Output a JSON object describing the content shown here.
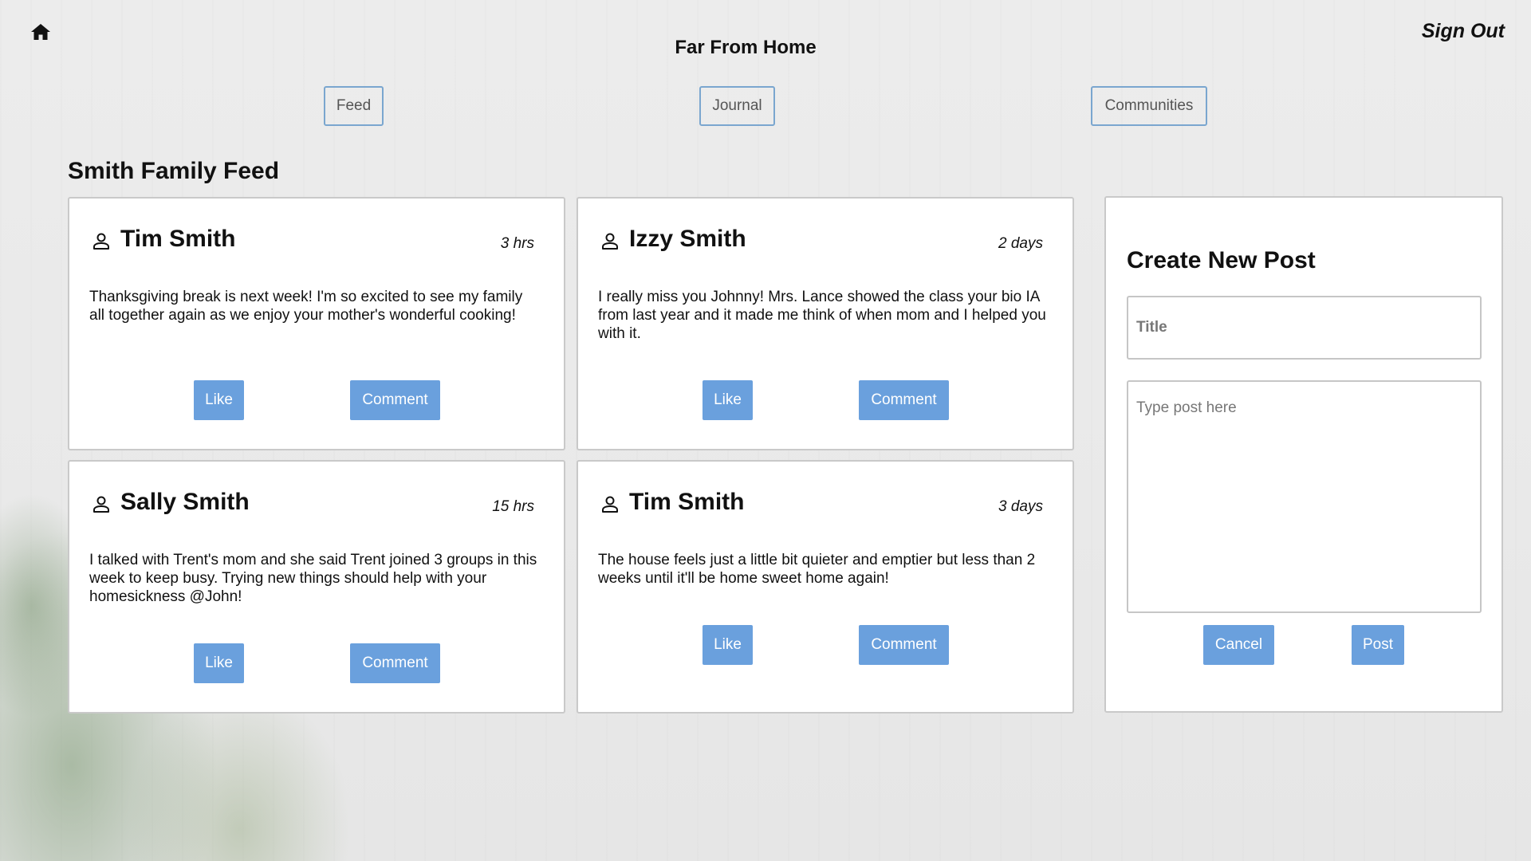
{
  "header": {
    "app_title": "Far From Home",
    "sign_out": "Sign Out",
    "home_icon": "home-icon"
  },
  "nav": {
    "feed": "Feed",
    "journal": "Journal",
    "communities": "Communities"
  },
  "feed": {
    "title": "Smith Family Feed",
    "posts": [
      {
        "author": "Tim Smith",
        "time": "3 hrs",
        "body": "Thanksgiving break is next week! I'm so excited to see my family all together again as we enjoy your mother's wonderful cooking!",
        "like_label": "Like",
        "comment_label": "Comment"
      },
      {
        "author": "Izzy Smith",
        "time": "2 days",
        "body": "I really miss you Johnny! Mrs. Lance showed the class your bio IA from last year and it made me think of when mom and I helped you with it.",
        "like_label": "Like",
        "comment_label": "Comment"
      },
      {
        "author": "Sally Smith",
        "time": "15 hrs",
        "body": "I talked with Trent's mom and she said Trent joined 3 groups in this week to keep busy. Trying new things should help with your homesickness @John!",
        "like_label": "Like",
        "comment_label": "Comment"
      },
      {
        "author": "Tim Smith",
        "time": "3 days",
        "body": "The house feels just a little bit quieter and emptier but less than 2 weeks until it'll be home sweet home again!",
        "like_label": "Like",
        "comment_label": "Comment"
      }
    ]
  },
  "create_post": {
    "title": "Create New Post",
    "title_placeholder": "Title",
    "title_value": "",
    "body_placeholder": "Type post here",
    "body_value": "",
    "cancel_label": "Cancel",
    "post_label": "Post"
  },
  "colors": {
    "accent_button": "#6aa0dd",
    "nav_border": "#7aa6cf",
    "card_border": "#c9c9c9"
  }
}
